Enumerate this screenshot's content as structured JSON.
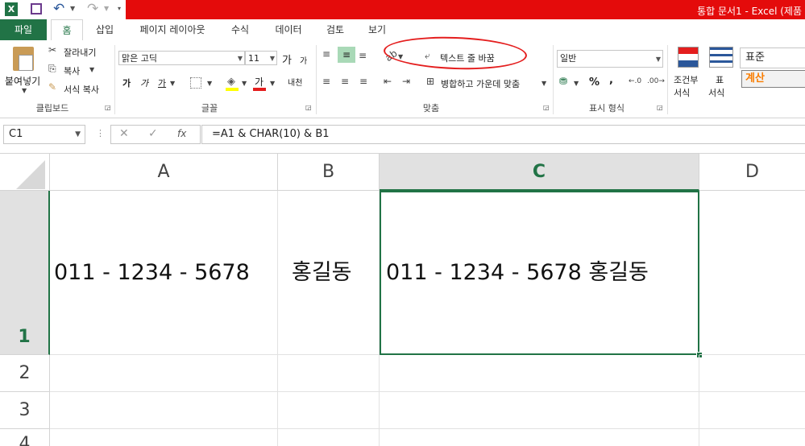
{
  "window": {
    "title": "통합 문서1 -  Excel (제품"
  },
  "tabs": [
    "파일",
    "홈",
    "삽입",
    "페이지 레이아웃",
    "수식",
    "데이터",
    "검토",
    "보기"
  ],
  "ribbon": {
    "clipboard": {
      "paste": "붙여넣기",
      "cut": "잘라내기",
      "copy": "복사",
      "format_painter": "서식 복사",
      "label": "클립보드"
    },
    "font": {
      "font_name": "맑은 고딕",
      "font_size": "11",
      "label": "글꼴",
      "grow": "가",
      "shrink": "가",
      "bold": "가",
      "italic": "가",
      "underline": "가",
      "phonetic": "내천"
    },
    "alignment": {
      "wrap_text": "텍스트 줄 바꿈",
      "merge_center": "병합하고 가운데 맞춤",
      "label": "맞춤"
    },
    "number": {
      "format": "일반",
      "label": "표시 형식",
      "percent": "%",
      "comma": ","
    },
    "styles": {
      "conditional": "조건부\n서식",
      "conditional_1": "조건부",
      "conditional_2": "서식",
      "table": "표",
      "table_2": "서식",
      "style_normal": "표준",
      "style_calc": "계산"
    }
  },
  "formula_bar": {
    "name_box": "C1",
    "formula": "=A1 & CHAR(10) & B1",
    "fx": "fx"
  },
  "grid": {
    "columns": [
      "A",
      "B",
      "C",
      "D"
    ],
    "rows": [
      "1",
      "2",
      "3",
      "4"
    ],
    "cells": {
      "A1": "011 - 1234 - 5678",
      "B1": "홍길동",
      "C1": "011 - 1234 - 5678 홍길동"
    }
  },
  "colors": {
    "excel_green": "#217346",
    "title_red": "#e40b0b",
    "annotation_red": "#e41e1e",
    "calc_orange": "#fa7d00"
  }
}
